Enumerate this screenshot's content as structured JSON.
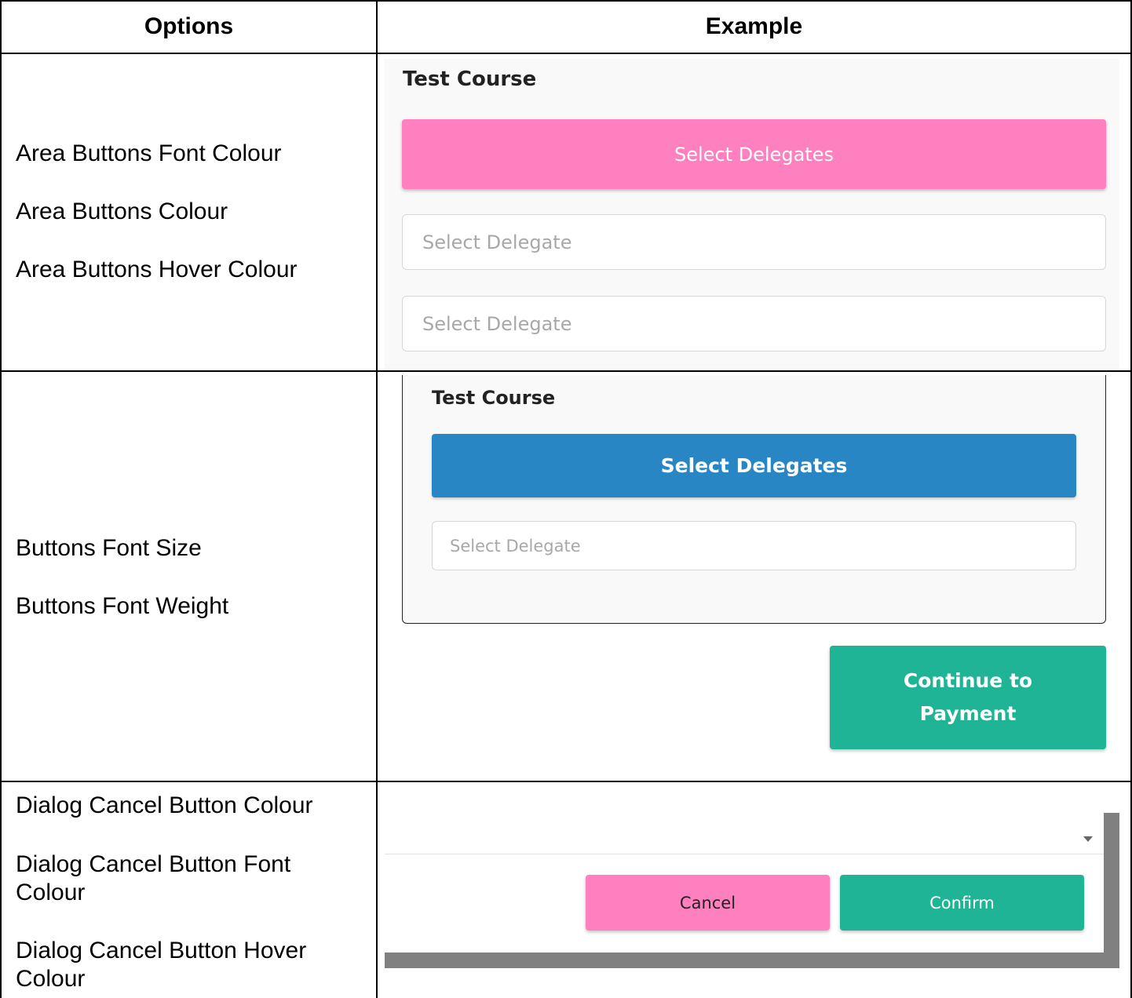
{
  "table": {
    "headers": {
      "options": "Options",
      "example": "Example"
    },
    "rows": [
      {
        "options": [
          "Area Buttons Font Colour",
          "Area Buttons Colour",
          "Area Buttons Hover Colour"
        ]
      },
      {
        "options": [
          "Buttons Font Size",
          "Buttons Font Weight"
        ]
      },
      {
        "options": [
          "Dialog Cancel Button Colour",
          "Dialog Cancel Button Font Colour",
          "Dialog Cancel Button Hover Colour"
        ]
      }
    ]
  },
  "example1": {
    "course_title": "Test Course",
    "area_button_label": "Select Delegates",
    "select_placeholder_1": "Select Delegate",
    "select_placeholder_2": "Select Delegate"
  },
  "example2": {
    "course_title": "Test Course",
    "button_label": "Select Delegates",
    "select_placeholder": "Select Delegate",
    "continue_line1": "Continue to",
    "continue_line2": "Payment"
  },
  "example3": {
    "cancel_label": "Cancel",
    "confirm_label": "Confirm",
    "dropdown_icon": "caret-down-icon"
  },
  "colors": {
    "pink": "#ff80bf",
    "blue": "#2886c5",
    "green": "#20b497",
    "scroll_gray": "#808080"
  }
}
